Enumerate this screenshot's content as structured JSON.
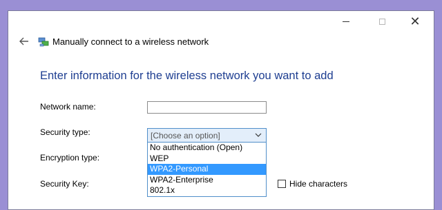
{
  "window": {
    "title": "Manually connect to a wireless network",
    "close_glyph": "✕"
  },
  "form": {
    "heading": "Enter information for the wireless network you want to add",
    "network_name": {
      "label": "Network name:",
      "value": ""
    },
    "security_type": {
      "label": "Security type:",
      "selected": "[Choose an option]",
      "options": [
        "No authentication (Open)",
        "WEP",
        "WPA2-Personal",
        "WPA2-Enterprise",
        "802.1x"
      ],
      "highlighted_option": "WPA2-Personal"
    },
    "encryption_type": {
      "label": "Encryption type:"
    },
    "security_key": {
      "label": "Security Key:"
    },
    "hide_characters": {
      "label": "Hide characters",
      "checked": false
    }
  },
  "colors": {
    "desktop": "#9a8fd4",
    "heading": "#1e3e91",
    "selection": "#3399ff",
    "dropdown_border": "#4f8ec9"
  },
  "icons": [
    "back-arrow-icon",
    "wireless-network-icon",
    "minimize-icon",
    "maximize-icon",
    "close-icon",
    "chevron-down-icon"
  ]
}
